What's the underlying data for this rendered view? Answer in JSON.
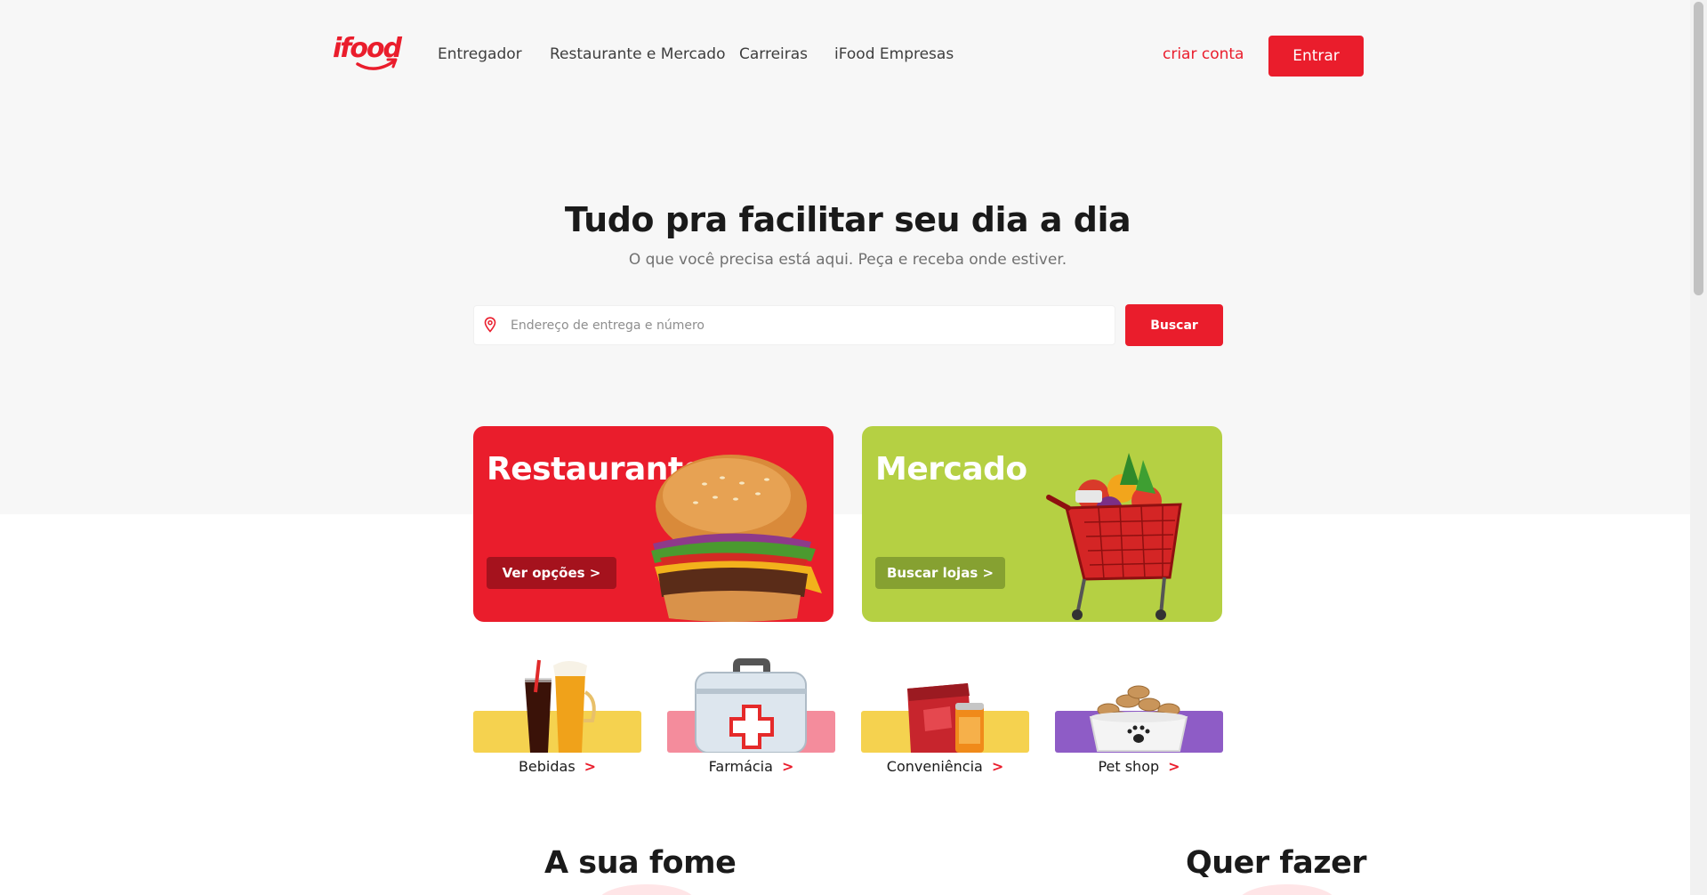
{
  "header": {
    "logo_text": "ifood",
    "nav": [
      "Entregador",
      "Restaurante e Mercado",
      "Carreiras",
      "iFood Empresas"
    ],
    "signup_label": "criar conta",
    "login_label": "Entrar"
  },
  "hero": {
    "title": "Tudo pra facilitar seu dia a dia",
    "subtitle": "O que você precisa está aqui. Peça e receba onde estiver.",
    "search_placeholder": "Endereço de entrega e número",
    "search_button": "Buscar"
  },
  "cards": [
    {
      "title": "Restaurante",
      "button": "Ver opções >",
      "color": "#ea1d2c",
      "icon": "burger-icon"
    },
    {
      "title": "Mercado",
      "button": "Buscar lojas >",
      "color": "#b5d043",
      "icon": "shopping-cart-icon"
    }
  ],
  "categories": [
    {
      "label": "Bebidas",
      "arrow": ">",
      "band_color": "#f5d24f",
      "icon": "drinks-icon"
    },
    {
      "label": "Farmácia",
      "arrow": ">",
      "band_color": "#f48c9c",
      "icon": "first-aid-kit-icon"
    },
    {
      "label": "Conveniência",
      "arrow": ">",
      "band_color": "#f5d24f",
      "icon": "snacks-icon"
    },
    {
      "label": "Pet shop",
      "arrow": ">",
      "band_color": "#8e5cc6",
      "icon": "pet-bowl-icon"
    }
  ],
  "bottom": {
    "left_title": "A sua fome",
    "right_title": "Quer fazer"
  },
  "colors": {
    "brand": "#ea1d2c",
    "hero_bg": "#f7f7f7"
  }
}
